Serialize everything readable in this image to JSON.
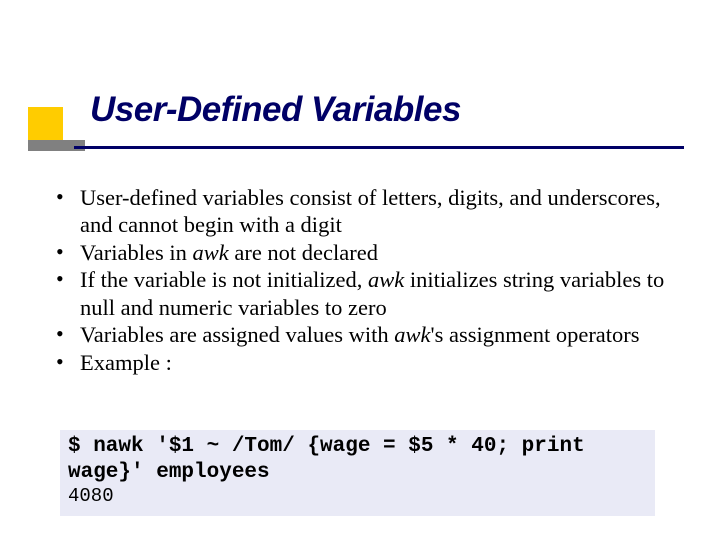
{
  "title": "User-Defined Variables",
  "bullets": {
    "b1": "User-defined variables consist of letters, digits, and underscores, and cannot begin with a digit",
    "b2a": "Variables in ",
    "b2b": "awk",
    "b2c": " are not declared",
    "b3a": "If the variable is not initialized, ",
    "b3b": "awk",
    "b3c": " initializes string variables to null and numeric variables to zero",
    "b4a": "Variables are assigned values with ",
    "b4b": "awk",
    "b4c": "'s assignment operators",
    "b5": "Example :"
  },
  "code": {
    "line1": "$ nawk '$1 ~ /Tom/ {wage = $5 * 40; print wage}' employees",
    "out": "4080"
  }
}
